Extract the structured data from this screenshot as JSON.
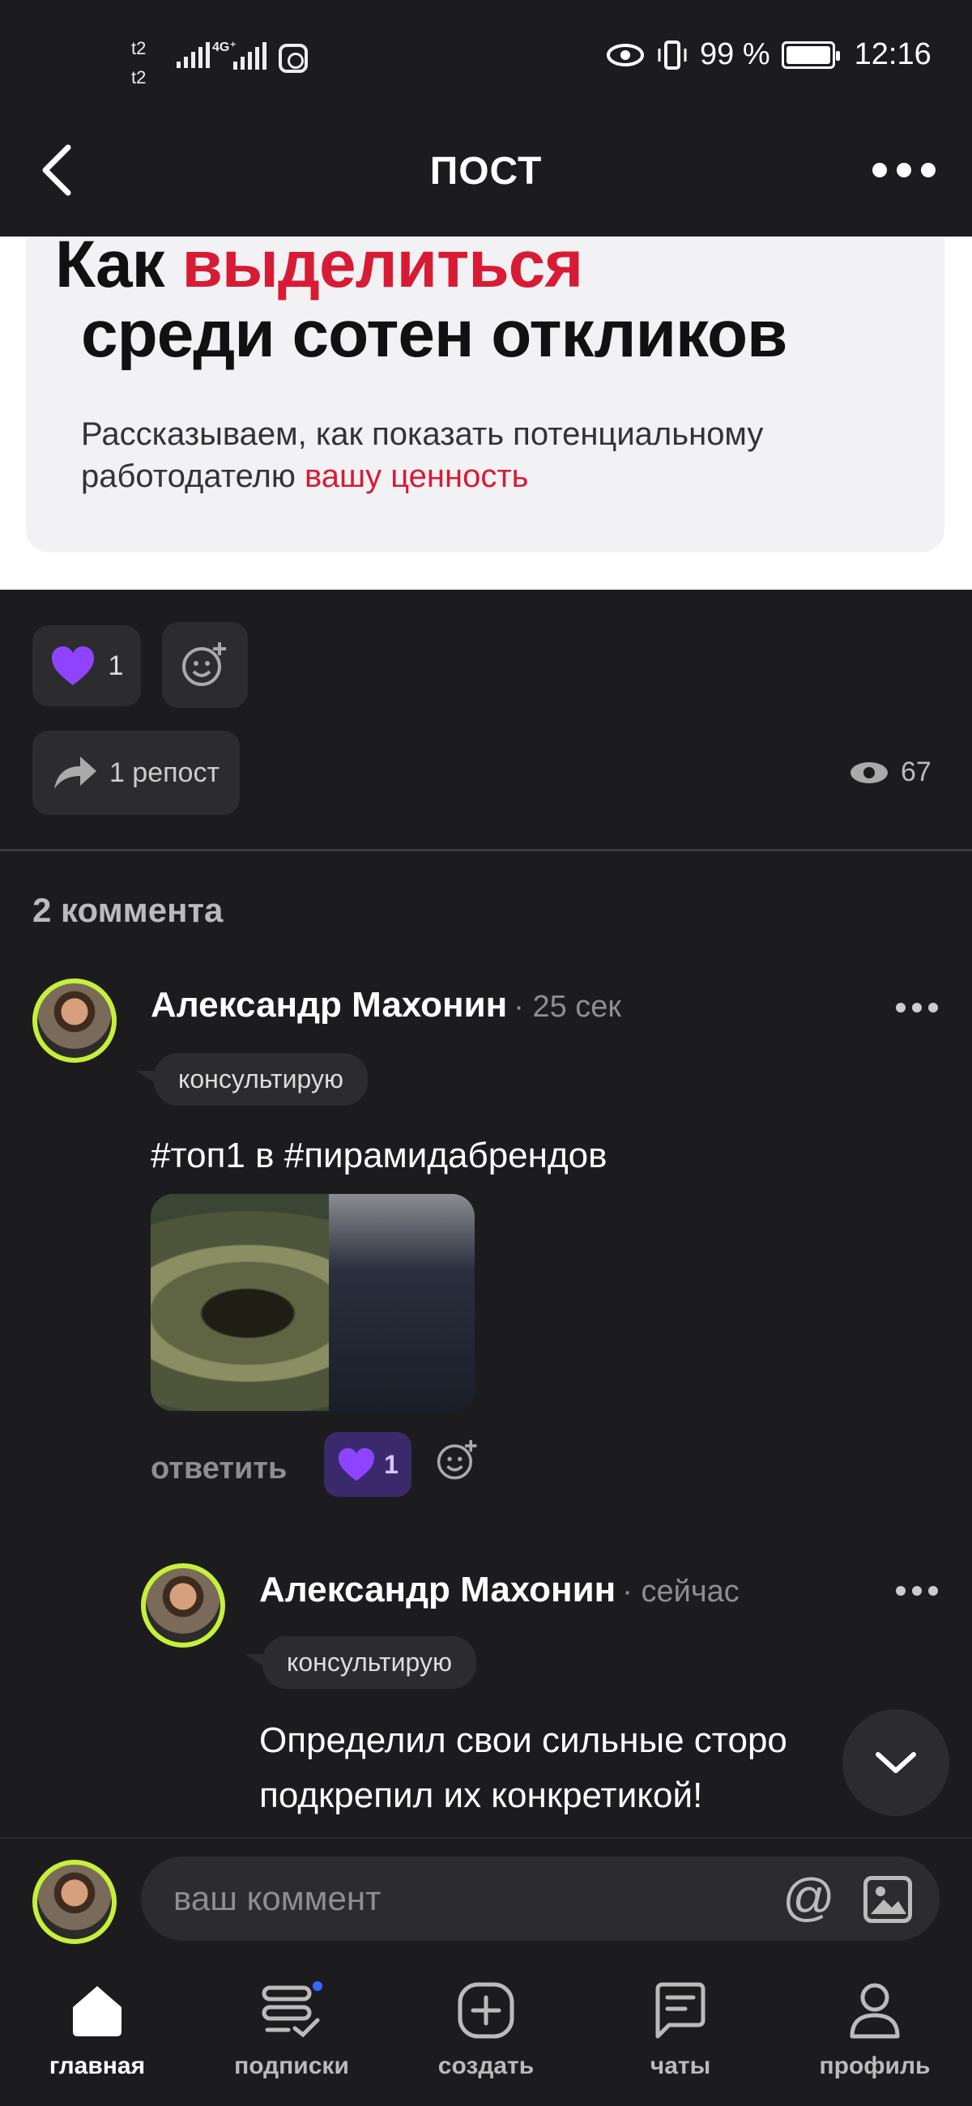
{
  "status_bar": {
    "carrier_1": "t2",
    "carrier_2": "t2",
    "network": "4G⁺",
    "battery_text": "99 %",
    "time": "12:16"
  },
  "header": {
    "title": "ПОСТ",
    "back_icon": "chevron-left-icon",
    "more_icon": "more-horizontal-icon"
  },
  "article": {
    "headline_part1": "Как ",
    "headline_part2_red": "выделиться",
    "headline_line2": "среди сотен откликов",
    "subtitle_line1": "Рассказываем, как показать потенциальному",
    "subtitle_line2_part1": "работодателю ",
    "subtitle_line2_part2_red": "вашу ценность"
  },
  "reactions": {
    "like_count": "1",
    "repost_label": "1 репост",
    "views_count": "67"
  },
  "comments": {
    "count_label": "2 коммента",
    "items": [
      {
        "author": "Александр Махонин",
        "time": "· 25 сек",
        "badge": "консультирую",
        "text": "#топ1 в #пирамидабрендов",
        "reply_label": "ответить",
        "like_count": "1"
      },
      {
        "author": "Александр Махонин",
        "time": "· сейчас",
        "badge": "консультирую",
        "text_line1": "Определил свои сильные сторо",
        "text_line2": "подкрепил их конкретикой!"
      }
    ]
  },
  "composer": {
    "placeholder": "ваш коммент",
    "at_symbol": "@"
  },
  "bottom_nav": {
    "items": [
      {
        "label": "главная",
        "icon": "home-icon",
        "active": true
      },
      {
        "label": "подписки",
        "icon": "subscriptions-icon",
        "active": false
      },
      {
        "label": "создать",
        "icon": "plus-square-icon",
        "active": false
      },
      {
        "label": "чаты",
        "icon": "chat-icon",
        "active": false
      },
      {
        "label": "профиль",
        "icon": "profile-icon",
        "active": false
      }
    ]
  },
  "colors": {
    "background": "#1c1c1e",
    "accent_red": "#d81b34",
    "avatar_ring": "#c6f03a",
    "like_purple": "#8e44ff",
    "notification_dot": "#2f6bff"
  }
}
